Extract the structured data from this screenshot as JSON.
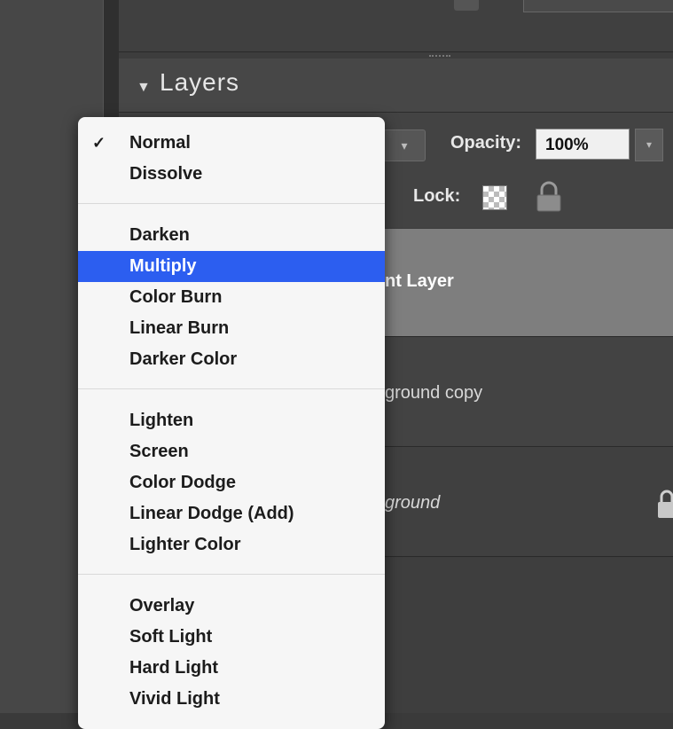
{
  "panel": {
    "title": "Layers",
    "opacity_label": "Opacity:",
    "opacity_value": "100%",
    "lock_label": "Lock:"
  },
  "layers": [
    {
      "name": "nt Layer",
      "selected": true
    },
    {
      "name": "ground copy",
      "selected": false
    },
    {
      "name": "ground",
      "selected": false,
      "locked": true
    }
  ],
  "blend_menu": {
    "groups": [
      [
        "Normal",
        "Dissolve"
      ],
      [
        "Darken",
        "Multiply",
        "Color Burn",
        "Linear Burn",
        "Darker Color"
      ],
      [
        "Lighten",
        "Screen",
        "Color Dodge",
        "Linear Dodge (Add)",
        "Lighter Color"
      ],
      [
        "Overlay",
        "Soft Light",
        "Hard Light",
        "Vivid Light"
      ]
    ],
    "checked": "Normal",
    "highlighted": "Multiply",
    "check_glyph": "✓"
  },
  "colors": {
    "highlight": "#2c5ef0",
    "panel_bg": "#3d3d3d",
    "selected_layer": "#7e7e7e"
  }
}
